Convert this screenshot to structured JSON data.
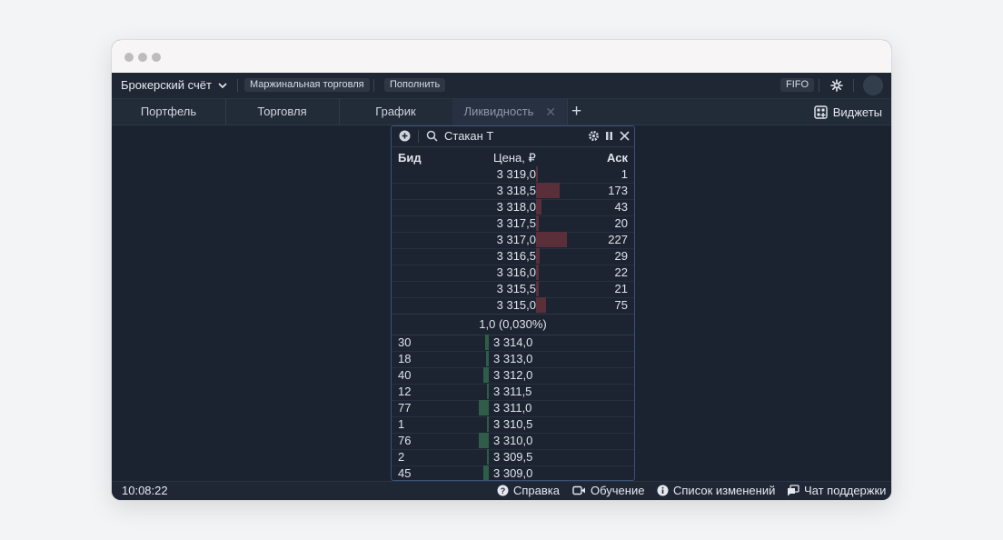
{
  "topbar": {
    "account_label": "Брокерский счёт",
    "margin_label": "Маржинальная торговля",
    "topup_label": "Пополнить",
    "fifo_label": "FIFO"
  },
  "tabs": [
    {
      "label": "Портфель"
    },
    {
      "label": "Торговля"
    },
    {
      "label": "График"
    },
    {
      "label": "Ликвидность"
    }
  ],
  "widgets_label": "Виджеты",
  "orderbook": {
    "title": "Стакан Т",
    "header": {
      "bid": "Бид",
      "price": "Цена, ₽",
      "ask": "Аск"
    },
    "asks": [
      {
        "price": "3 319,0",
        "ask": "1"
      },
      {
        "price": "3 318,5",
        "ask": "173"
      },
      {
        "price": "3 318,0",
        "ask": "43"
      },
      {
        "price": "3 317,5",
        "ask": "20"
      },
      {
        "price": "3 317,0",
        "ask": "227"
      },
      {
        "price": "3 316,5",
        "ask": "29"
      },
      {
        "price": "3 316,0",
        "ask": "22"
      },
      {
        "price": "3 315,5",
        "ask": "21"
      },
      {
        "price": "3 315,0",
        "ask": "75"
      }
    ],
    "spread": "1,0 (0,030%)",
    "bids": [
      {
        "bid": "30",
        "price": "3 314,0"
      },
      {
        "bid": "18",
        "price": "3 313,0"
      },
      {
        "bid": "40",
        "price": "3 312,0"
      },
      {
        "bid": "12",
        "price": "3 311,5"
      },
      {
        "bid": "77",
        "price": "3 311,0"
      },
      {
        "bid": "1",
        "price": "3 310,5"
      },
      {
        "bid": "76",
        "price": "3 310,0"
      },
      {
        "bid": "2",
        "price": "3 309,5"
      },
      {
        "bid": "45",
        "price": "3 309,0"
      }
    ]
  },
  "status": {
    "time": "10:08:22",
    "help": "Справка",
    "learning": "Обучение",
    "changelog": "Список изменений",
    "support": "Чат поддержки"
  },
  "colors": {
    "ask_bar": "#5a2f3a",
    "bid_bar": "#2f5d4a",
    "panel_border": "#3a5278"
  }
}
